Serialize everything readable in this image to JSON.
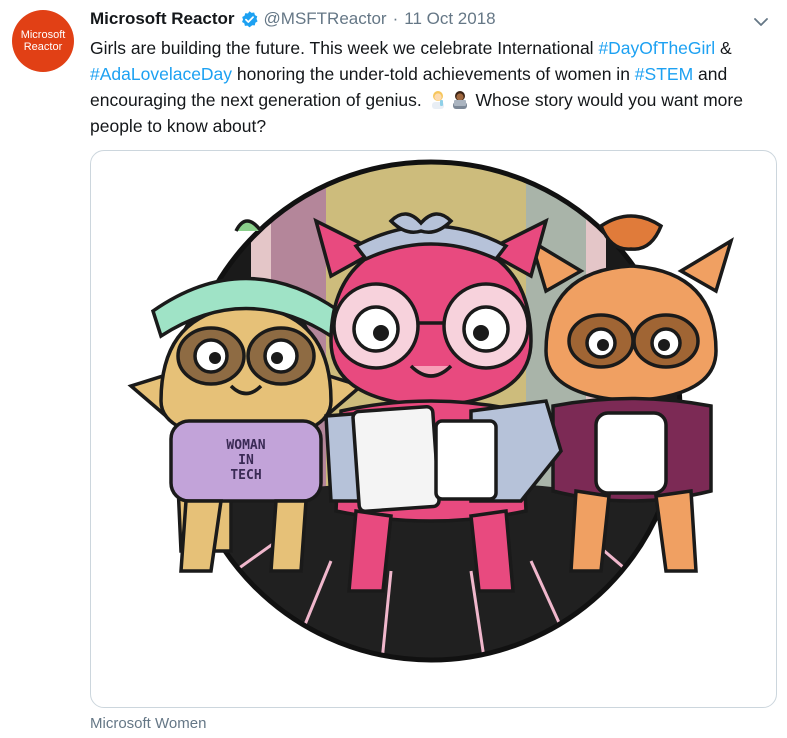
{
  "account": {
    "avatar_line1": "Microsoft",
    "avatar_line2": "Reactor",
    "name": "Microsoft Reactor",
    "handle": "@MSFTReactor",
    "separator": "·",
    "date": "11 Oct 2018"
  },
  "tweet": {
    "text_1": "Girls are building the future. This week we celebrate International ",
    "tag_1": "#DayOfTheGirl",
    "text_2": " ",
    "tag_2_prefix": "& ",
    "tag_2": "#AdaLovelaceDay",
    "text_3": " honoring the under-told achievements of women in ",
    "tag_3": "#STEM",
    "text_4": " and encouraging the next generation of genius. ",
    "text_5": " Whose story would you want more people to know about?"
  },
  "media": {
    "shirt_text_1": "WOMAN",
    "shirt_text_2": "IN",
    "shirt_text_3": "TECH"
  },
  "footer": {
    "source": "Microsoft Women"
  },
  "icons": [
    "verified-badge-icon",
    "chevron-down-icon",
    "woman-scientist-emoji",
    "woman-technologist-emoji"
  ],
  "colors": {
    "link": "#1da1f2",
    "secondary_text": "#657786",
    "avatar_bg": "#e14015"
  }
}
